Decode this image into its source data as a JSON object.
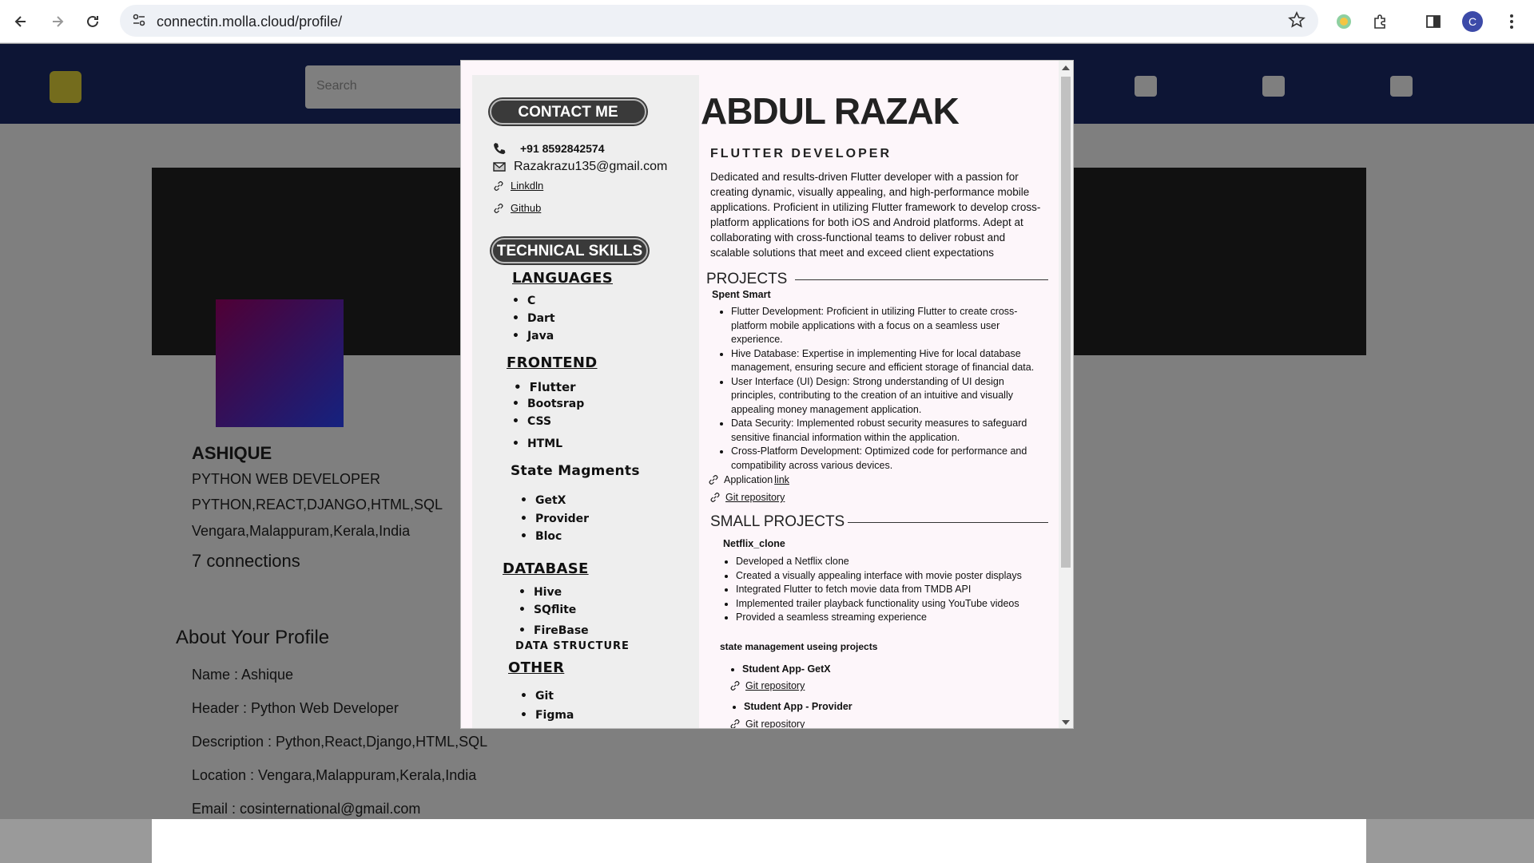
{
  "browser": {
    "url": "connectin.molla.cloud/profile/",
    "profile_initial": "C"
  },
  "background_page": {
    "search_placeholder": "Search",
    "profile_name": "ASHIQUE",
    "profile_title": "PYTHON WEB DEVELOPER",
    "profile_skills": "PYTHON,REACT,DJANGO,HTML,SQL",
    "profile_location": "Vengara,Malappuram,Kerala,India",
    "connections": "7 connections",
    "about_title": "About Your Profile",
    "about_name": "Name :  Ashique",
    "about_header": "Header :  Python Web Developer",
    "about_description": "Description :  Python,React,Django,HTML,SQL",
    "about_location": "Location :  Vengara,Malappuram,Kerala,India",
    "about_email": "Email :  cosinternational@gmail.com"
  },
  "resume": {
    "contact_heading": "CONTACT ME",
    "phone": "+91 8592842574",
    "email": "Razakrazu135@gmail.com",
    "linkedin": "Linkdln",
    "github": "Github",
    "skills_heading": "TECHNICAL SKILLS",
    "languages_heading": "LANGUAGES",
    "languages": [
      "C",
      "Dart",
      "Java"
    ],
    "frontend_heading": "FRONTEND",
    "frontend": [
      "Flutter",
      "Bootsrap",
      "CSS",
      "HTML"
    ],
    "state_heading": "State Magments",
    "state": [
      "GetX",
      "Provider",
      "Bloc"
    ],
    "database_heading": "DATABASE",
    "database": [
      "Hive",
      "SQflite",
      "FireBase"
    ],
    "ds_heading": "DATA STRUCTURE",
    "other_heading": "OTHER",
    "other": [
      "Git",
      "Figma"
    ],
    "name": "ABDUL RAZAK",
    "role": "FLUTTER DEVELOPER",
    "summary": "Dedicated and results-driven Flutter developer with a passion for creating dynamic, visually appealing, and high-performance mobile applications. Proficient in utilizing Flutter framework to develop cross-platform applications for both iOS and Android platforms. Adept at collaborating with cross-functional teams to deliver robust and scalable solutions that meet and exceed client expectations",
    "projects_heading": "PROJECTS",
    "project1_name": "Spent Smart",
    "project1_points": [
      "Flutter Development: Proficient in utilizing Flutter to create cross-platform mobile applications with a focus on a seamless user experience.",
      "Hive Database: Expertise in implementing Hive for local database management, ensuring secure and efficient storage of financial data.",
      "User Interface (UI) Design: Strong understanding of UI design principles, contributing to the creation of an intuitive and visually appealing money management application.",
      "Data Security: Implemented robust security measures to safeguard sensitive financial information within the application.",
      "Cross-Platform Development: Optimized code for performance and compatibility across various devices."
    ],
    "application_label": "Application",
    "application_link": "link",
    "git_repo": "Git repository",
    "small_projects_heading": "SMALL PROJECTS",
    "netflix_name": "Netflix_clone",
    "netflix_points": [
      "Developed a Netflix clone",
      "Created a visually appealing interface with movie poster displays",
      "Integrated Flutter to fetch movie data from TMDB API",
      "Implemented trailer playback functionality using YouTube videos",
      "Provided a seamless streaming experience"
    ],
    "state_projects_heading": "state management useing projects",
    "student_getx": "Student App- GetX",
    "student_provider": "Student App - Provider"
  }
}
